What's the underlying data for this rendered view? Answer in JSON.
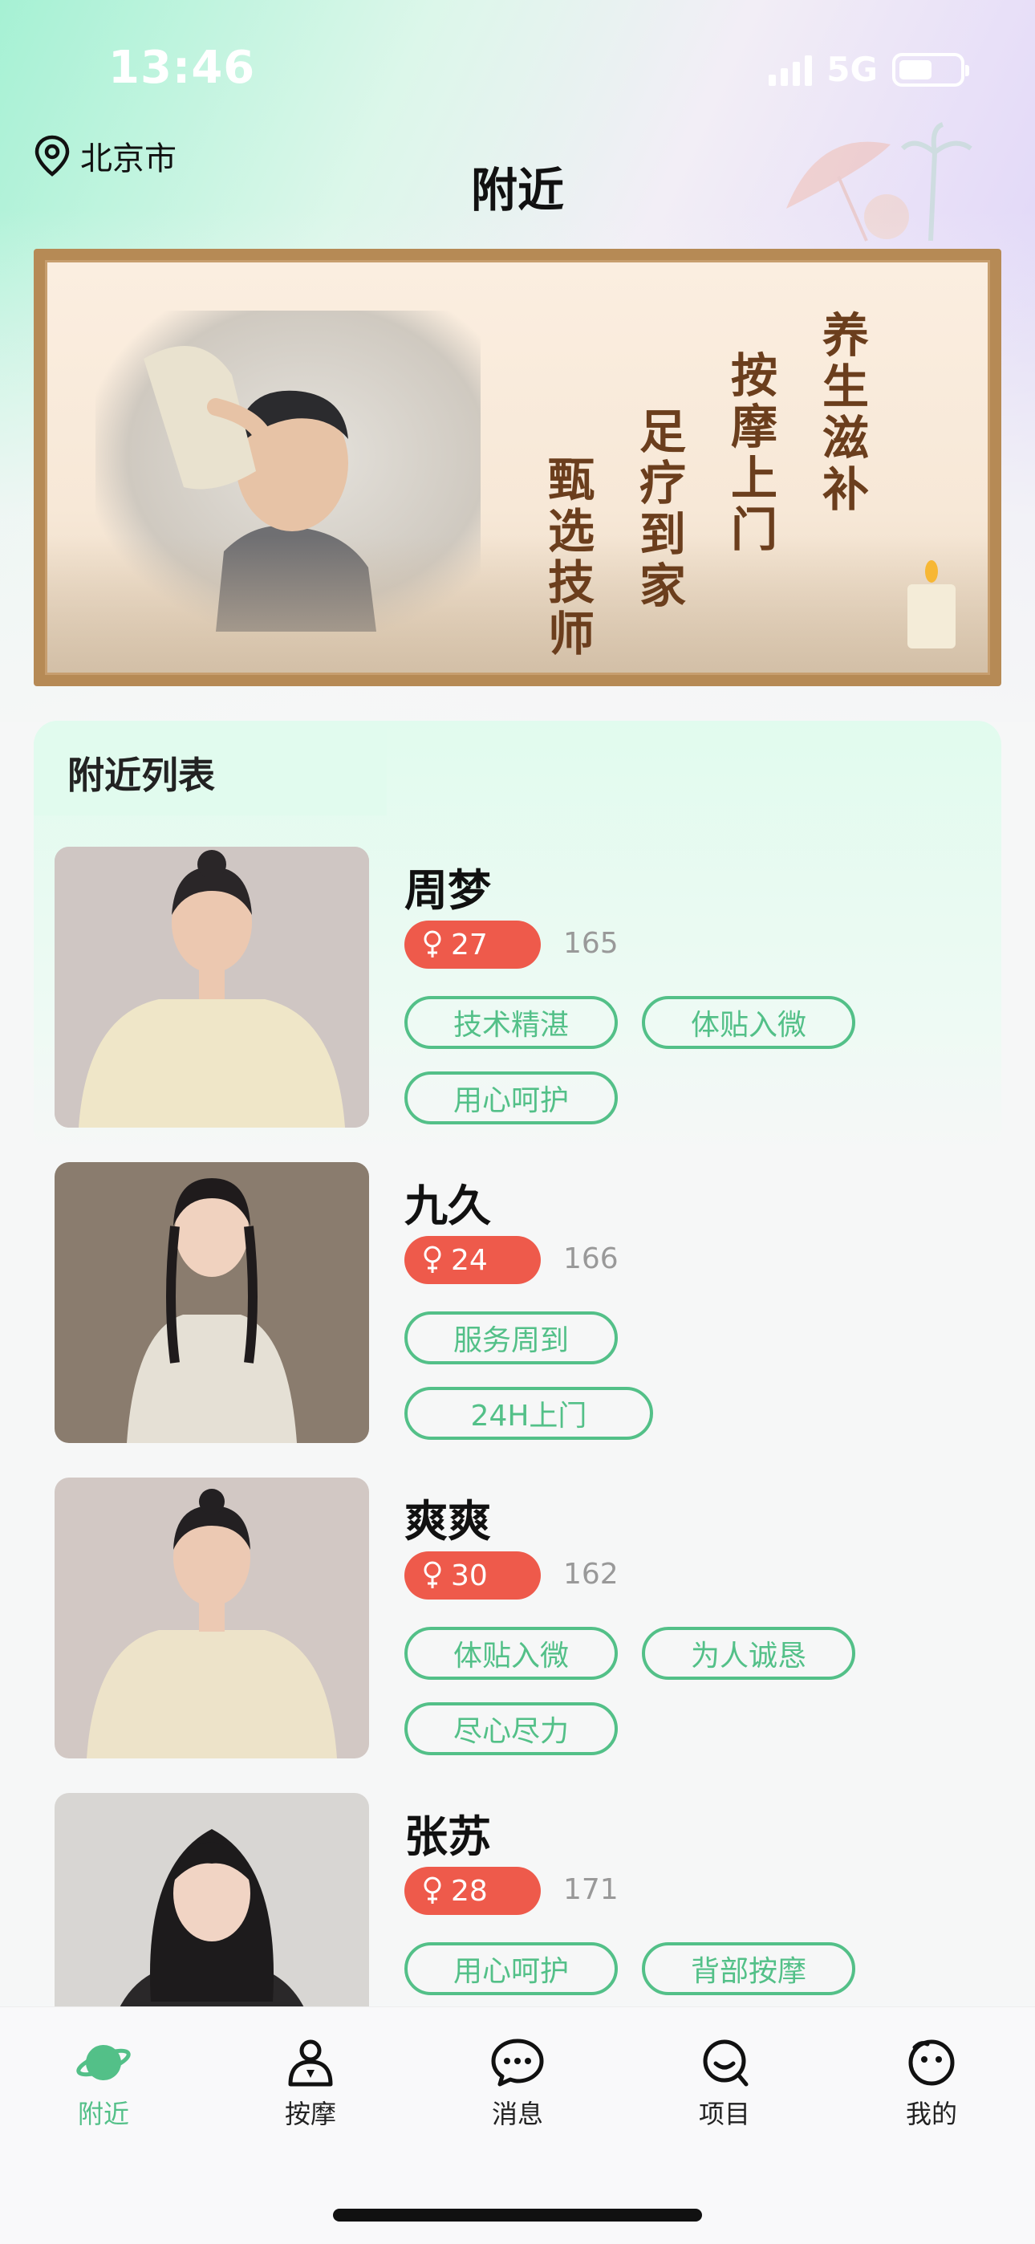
{
  "status_bar": {
    "time": "13:46",
    "network": "5G"
  },
  "header": {
    "location": "北京市",
    "title": "附近"
  },
  "banner": {
    "lines": [
      "养生滋补",
      "按摩上门",
      "足疗到家",
      "甄选技师"
    ]
  },
  "list": {
    "title": "附近列表",
    "items": [
      {
        "name": "周梦",
        "age": "27",
        "height": "165",
        "tags": [
          "技术精湛",
          "体贴入微",
          "用心呵护"
        ]
      },
      {
        "name": "九久",
        "age": "24",
        "height": "166",
        "tags": [
          "服务周到",
          "24H上门"
        ]
      },
      {
        "name": "爽爽",
        "age": "30",
        "height": "162",
        "tags": [
          "体贴入微",
          "为人诚恳",
          "尽心尽力"
        ]
      },
      {
        "name": "张苏",
        "age": "28",
        "height": "171",
        "tags": [
          "用心呵护",
          "背部按摩"
        ]
      }
    ]
  },
  "nav": [
    {
      "label": "附近",
      "icon": "planet-icon",
      "active": true
    },
    {
      "label": "按摩",
      "icon": "person-icon",
      "active": false
    },
    {
      "label": "消息",
      "icon": "chat-bubble-icon",
      "active": false
    },
    {
      "label": "项目",
      "icon": "smile-search-icon",
      "active": false
    },
    {
      "label": "我的",
      "icon": "face-icon",
      "active": false
    }
  ],
  "colors": {
    "accent": "#53c088",
    "age_badge": "#ee5a4b",
    "banner_text": "#6b3e1d"
  }
}
